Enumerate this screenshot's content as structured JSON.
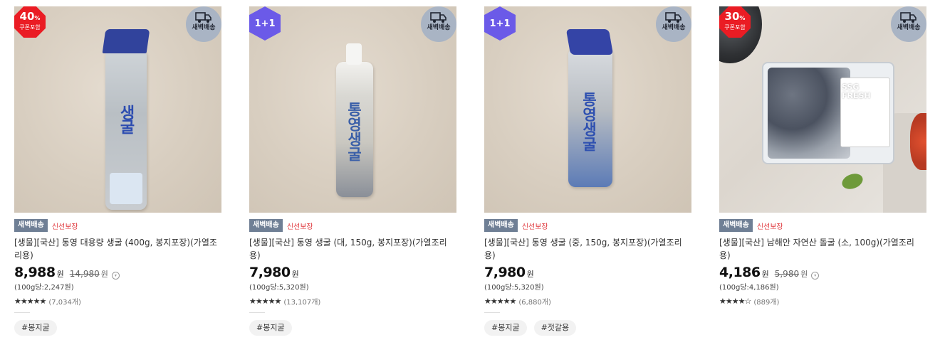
{
  "products": [
    {
      "badge": {
        "type": "discount",
        "value": "40",
        "sign": "%",
        "note": "쿠폰포함"
      },
      "dawn_badge": "새벽배송",
      "tags": {
        "dawn": "새벽배송",
        "fresh": "신선보장"
      },
      "title": "[생물][국산] 통영 대용량 생굴 (400g, 봉지포장)(가열조리용)",
      "price": "8,988",
      "won": "원",
      "original_price": "14,980",
      "original_won": "원",
      "unit_price": "(100g당:2,247원)",
      "rating": 4.8,
      "stars": "★★★★★",
      "reviews": "(7,034개)",
      "hashtags": [
        "#봉지굴"
      ],
      "pack_label": "생굴"
    },
    {
      "badge": {
        "type": "oneplus",
        "value": "1+1"
      },
      "dawn_badge": "새벽배송",
      "tags": {
        "dawn": "새벽배송",
        "fresh": "신선보장"
      },
      "title": "[생물][국산] 통영 생굴 (대, 150g, 봉지포장)(가열조리용)",
      "price": "7,980",
      "won": "원",
      "unit_price": "(100g당:5,320원)",
      "rating": 4.9,
      "stars": "★★★★★",
      "reviews": "(13,107개)",
      "hashtags": [
        "#봉지굴"
      ],
      "pack_label": "통영생굴"
    },
    {
      "badge": {
        "type": "oneplus",
        "value": "1+1"
      },
      "dawn_badge": "새벽배송",
      "tags": {
        "dawn": "새벽배송",
        "fresh": "신선보장"
      },
      "title": "[생물][국산] 통영 생굴 (중, 150g, 봉지포장)(가열조리용)",
      "price": "7,980",
      "won": "원",
      "unit_price": "(100g당:5,320원)",
      "rating": 4.9,
      "stars": "★★★★★",
      "reviews": "(6,880개)",
      "hashtags": [
        "#봉지굴",
        "#젓갈용"
      ],
      "pack_label": "통영생굴"
    },
    {
      "badge": {
        "type": "discount",
        "value": "30",
        "sign": "%",
        "note": "쿠폰포함"
      },
      "dawn_badge": "새벽배송",
      "tags": {
        "dawn": "새벽배송",
        "fresh": "신선보장"
      },
      "title": "[생물][국산] 남해안 자연산 돌굴 (소, 100g)(가열조리용)",
      "price": "4,186",
      "won": "원",
      "original_price": "5,980",
      "original_won": "원",
      "unit_price": "(100g당:4,186원)",
      "rating": 4.6,
      "stars": "★★★★☆",
      "reviews": "(889개)",
      "hashtags": [],
      "pack_label": "SSG FRESH"
    }
  ],
  "colors": {
    "discount_badge": "#ea1c24",
    "oneplus_badge": "#6b5ae8",
    "dawn_tag": "#6f7f95",
    "fresh_tag": "#e0393e"
  },
  "icons": {
    "dawn_badge": "truck-icon",
    "info": "info-circle-icon",
    "star": "star-icon"
  }
}
